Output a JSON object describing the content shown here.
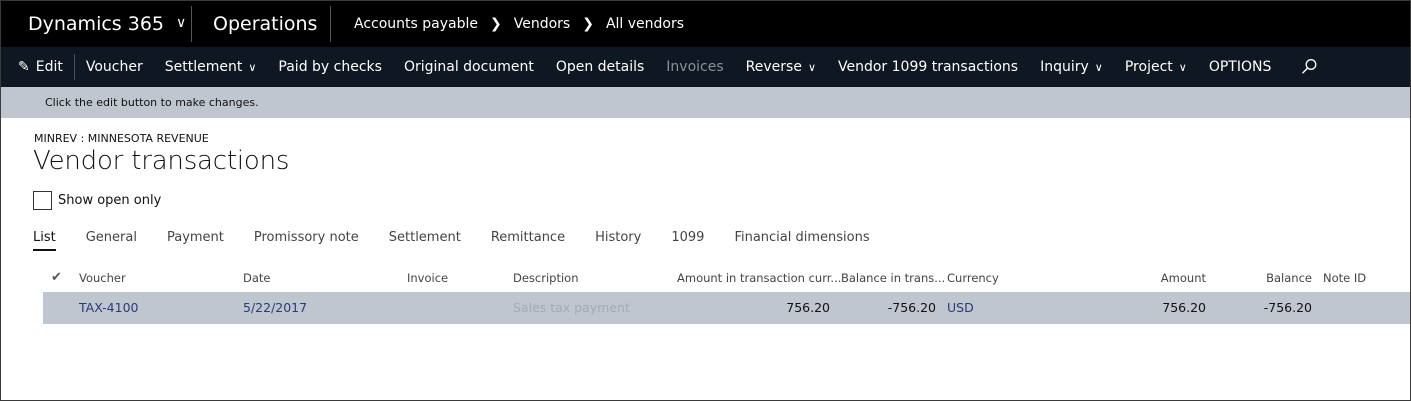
{
  "topbar": {
    "app_name": "Dynamics 365",
    "module": "Operations",
    "breadcrumb": [
      "Accounts payable",
      "Vendors",
      "All vendors"
    ],
    "background": "#000000"
  },
  "actions": {
    "edit": "Edit",
    "voucher": "Voucher",
    "settlement": "Settlement",
    "paid_by_checks": "Paid by checks",
    "original_document": "Original document",
    "open_details": "Open details",
    "invoices": "Invoices",
    "reverse": "Reverse",
    "vendor_1099": "Vendor 1099 transactions",
    "inquiry": "Inquiry",
    "project": "Project",
    "options": "OPTIONS",
    "search_icon": "search-icon"
  },
  "message": "Click the edit button to make changes.",
  "page": {
    "caption": "MINREV : MINNESOTA REVENUE",
    "title": "Vendor transactions",
    "show_open_only": "Show open only"
  },
  "tabs": [
    "List",
    "General",
    "Payment",
    "Promissory note",
    "Settlement",
    "Remittance",
    "History",
    "1099",
    "Financial dimensions"
  ],
  "grid": {
    "headers": {
      "voucher": "Voucher",
      "date": "Date",
      "invoice": "Invoice",
      "description": "Description",
      "amount_cur": "Amount in transaction curr...",
      "balance_trans": "Balance in trans...",
      "currency": "Currency",
      "amount": "Amount",
      "balance": "Balance",
      "note_id": "Note ID"
    },
    "rows": [
      {
        "voucher": "TAX-4100",
        "date": "5/22/2017",
        "invoice": "",
        "description": "Sales tax payment",
        "amount_cur": "756.20",
        "balance_trans": "-756.20",
        "currency": "USD",
        "amount": "756.20",
        "balance": "-756.20",
        "note_id": ""
      }
    ]
  },
  "colors": {
    "action_bar": "#0f1723",
    "message_bar": "#c0c6cf",
    "selected_row": "#c0c6cf",
    "link": "#2b3a78"
  }
}
